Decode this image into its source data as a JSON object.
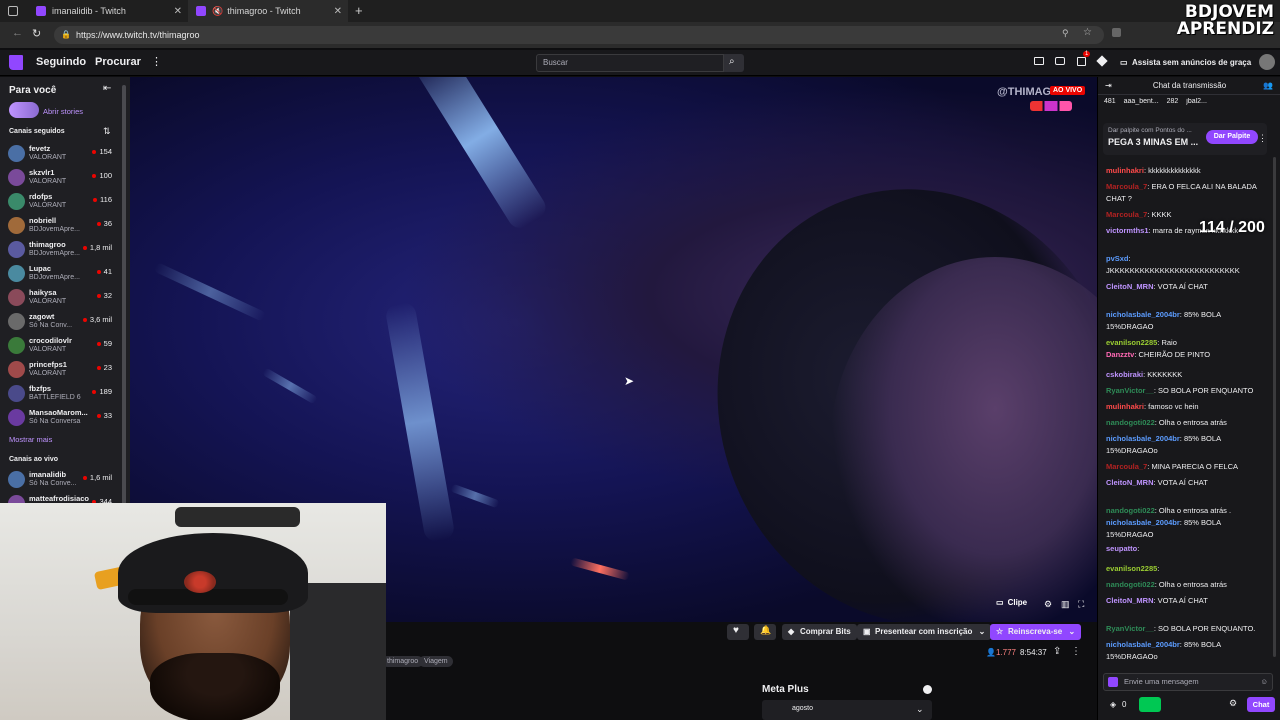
{
  "browser": {
    "tabs": [
      {
        "title": "imanalidib - Twitch"
      },
      {
        "title": "thimagroo - Twitch"
      }
    ],
    "url": "https://www.twitch.tv/thimagroo"
  },
  "watermark": {
    "line1": "BDJOVEM",
    "line2": "APRENDIZ"
  },
  "nav": {
    "following": "Seguindo",
    "browse": "Procurar",
    "search_placeholder": "Buscar",
    "adfree": "Assista sem anúncios de graça",
    "notif_count": "1"
  },
  "sidebar": {
    "for_you": "Para você",
    "stories": "Abrir stories",
    "followed_label": "Canais seguidos",
    "channels": [
      {
        "name": "fevetz",
        "game": "VALORANT",
        "viewers": "154"
      },
      {
        "name": "skzvlr1",
        "game": "VALORANT",
        "viewers": "100"
      },
      {
        "name": "rdofps",
        "game": "VALORANT",
        "viewers": "116"
      },
      {
        "name": "nobriell",
        "game": "BDJovemApre...",
        "viewers": "36"
      },
      {
        "name": "thimagroo",
        "game": "BDJovemApre...",
        "viewers": "1,8 mil"
      },
      {
        "name": "Lupac",
        "game": "BDJovemApre...",
        "viewers": "41"
      },
      {
        "name": "haikysa",
        "game": "VALORANT",
        "viewers": "32"
      },
      {
        "name": "zagowt",
        "game": "Só Na Conv...",
        "viewers": "3,6 mil"
      },
      {
        "name": "crocodilovlr",
        "game": "VALORANT",
        "viewers": "59"
      },
      {
        "name": "princefps1",
        "game": "VALORANT",
        "viewers": "23"
      },
      {
        "name": "fbzfps",
        "game": "BATTLEFIELD 6",
        "viewers": "189"
      },
      {
        "name": "MansaoMarom...",
        "game": "Só Na Conversa",
        "viewers": "33"
      }
    ],
    "show_more": "Mostrar mais",
    "live_label": "Canais ao vivo",
    "live_channels": [
      {
        "name": "imanalidib",
        "game": "Só Na Conve...",
        "viewers": "1,6 mil"
      },
      {
        "name": "matteafrodisiaco",
        "game": "",
        "viewers": "344"
      }
    ]
  },
  "video": {
    "live": "AO VIVO",
    "handle": "@THIMAGROO",
    "clip": "Clipe"
  },
  "below": {
    "buy_bits": "Comprar Bits",
    "gift_sub": "Presentear com inscrição",
    "resub": "Reinscreva-se",
    "tags": [
      "thimagroo",
      "Viagem"
    ],
    "viewers": "1.777",
    "uptime": "8:54:37",
    "meta_plus": "Meta Plus",
    "month": "agosto"
  },
  "chat": {
    "title": "Chat da transmissão",
    "top": [
      {
        "count": "481",
        "name": "aaa_bent..."
      },
      {
        "count": "282",
        "name": "jbal2..."
      }
    ],
    "prediction": {
      "label": "Dar palpite com Pontos do ...",
      "title": "PEGA 3 MINAS EM ...",
      "button": "Dar Palpite"
    },
    "counter": "114 / 200",
    "messages": [
      {
        "user": "mulinhakri",
        "color": "#ff4a4a",
        "text": ": kkkkkkkkkkkkkk"
      },
      {
        "user": "Marcoula_7",
        "color": "#b22222",
        "text": ": ERA O FELCA ALI NA BALADA CHAT ?"
      },
      {
        "user": "Marcoula_7",
        "color": "#b22222",
        "text": ": KKKK"
      },
      {
        "user": "victormths1",
        "color": "#bf94ff",
        "text": ": marra de rayman kkkkkkk"
      },
      {
        "user": "pvSxd",
        "color": "#5c9cff",
        "text": ": JKKKKKKKKKKKKKKKKKKKKKKKKKK"
      },
      {
        "user": "CleitoN_MRN",
        "color": "#bf94ff",
        "text": ": VOTA AÍ CHAT"
      },
      {
        "user": "nicholasbale_2004br",
        "color": "#5c9cff",
        "text": ": 85% BOLA 15%DRAGAO"
      },
      {
        "user": "evanilson2285",
        "color": "#9acd32",
        "text": ": Raio"
      },
      {
        "user": "Danzztv",
        "color": "#ff69b4",
        "text": ": CHEIRÃO DE PINTO"
      },
      {
        "user": "cskobiraki",
        "color": "#bf94ff",
        "text": ": KKKKKKK"
      },
      {
        "user": "RyanVictor__",
        "color": "#2e8b57",
        "text": ": SO BOLA POR ENQUANTO"
      },
      {
        "user": "mulinhakri",
        "color": "#ff4a4a",
        "text": ": famoso vc hein"
      },
      {
        "user": "nandogoti022",
        "color": "#2e8b57",
        "text": ": Olha o entrosa atrás"
      },
      {
        "user": "nicholasbale_2004br",
        "color": "#5c9cff",
        "text": ": 85% BOLA 15%DRAGAOo"
      },
      {
        "user": "Marcoula_7",
        "color": "#b22222",
        "text": ": MINA PARECIA O FELCA"
      },
      {
        "user": "CleitoN_MRN",
        "color": "#bf94ff",
        "text": ": VOTA AÍ CHAT"
      },
      {
        "user": "nandogoti022",
        "color": "#2e8b57",
        "text": ": Olha o entrosa atrás ."
      },
      {
        "user": "nicholasbale_2004br",
        "color": "#5c9cff",
        "text": ": 85% BOLA 15%DRAGAO"
      },
      {
        "user": "seupatto",
        "color": "#bf94ff",
        "text": ":"
      },
      {
        "user": "evanilson2285",
        "color": "#9acd32",
        "text": ":"
      },
      {
        "user": "nandogoti022",
        "color": "#2e8b57",
        "text": ": Olha o entrosa atrás"
      },
      {
        "user": "CleitoN_MRN",
        "color": "#bf94ff",
        "text": ": VOTA AÍ CHAT"
      },
      {
        "user": "RyanVictor__",
        "color": "#2e8b57",
        "text": ": SO BOLA POR ENQUANTO."
      },
      {
        "user": "nicholasbale_2004br",
        "color": "#5c9cff",
        "text": ": 85% BOLA 15%DRAGAOo"
      }
    ],
    "input_placeholder": "Envie uma mensagem",
    "points": "0",
    "send": "Chat"
  }
}
